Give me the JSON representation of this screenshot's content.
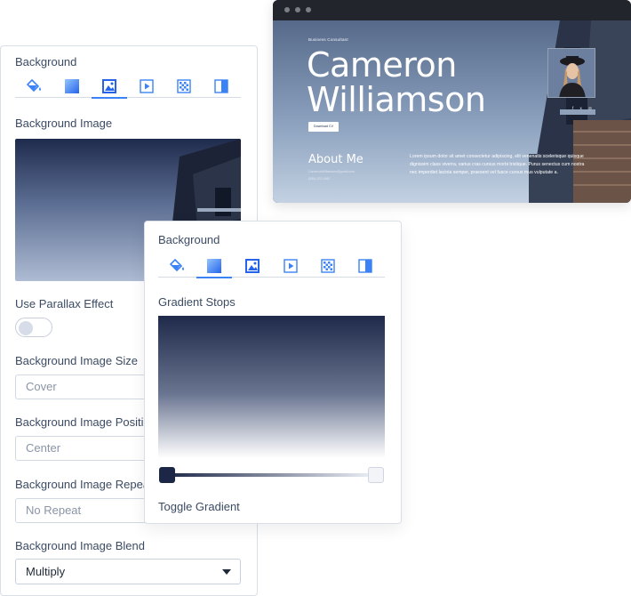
{
  "preview": {
    "kicker": "Business Consultant",
    "name_line1": "Cameron",
    "name_line2": "Williamson",
    "cv_button": "Download CV",
    "social_icons": [
      "facebook-icon",
      "twitter-icon",
      "instagram-icon"
    ],
    "about_title": "About Me",
    "about_meta_1": "CameronWilliamson@gmail.com",
    "about_meta_2": "(555) 123-4567",
    "about_text": "Lorem ipsum dolor sit amet consectetur adipiscing, elit venenatis scelerisque quisque dignissim class viverra, varius cras cursus morbi tristique. Purus senectus cum nostra nec imperdiet lacinia semper, praesent vel fusce cursus mus vulputate a."
  },
  "back_panel": {
    "heading": "Background",
    "tabs": [
      {
        "icon": "paint-bucket-icon",
        "active": false
      },
      {
        "icon": "gradient-icon",
        "active": false
      },
      {
        "icon": "image-icon",
        "active": true
      },
      {
        "icon": "video-icon",
        "active": false
      },
      {
        "icon": "pattern-icon",
        "active": false
      },
      {
        "icon": "overlay-icon",
        "active": false
      }
    ],
    "image_label": "Background Image",
    "parallax_label": "Use Parallax Effect",
    "parallax_enabled": false,
    "size_label": "Background Image Size",
    "size_value": "Cover",
    "position_label": "Background Image Position",
    "position_value": "Center",
    "repeat_label": "Background Image Repeat",
    "repeat_value": "No Repeat",
    "blend_label": "Background Image Blend",
    "blend_value": "Multiply"
  },
  "front_panel": {
    "heading": "Background",
    "active_tab": "gradient-icon",
    "stops_label": "Gradient Stops",
    "stop_colors": [
      "#1c2747",
      "#f2f4f8"
    ],
    "toggle_label": "Toggle Gradient"
  },
  "colors": {
    "accent": "#3b82f6",
    "dark_navy": "#1c2747"
  }
}
